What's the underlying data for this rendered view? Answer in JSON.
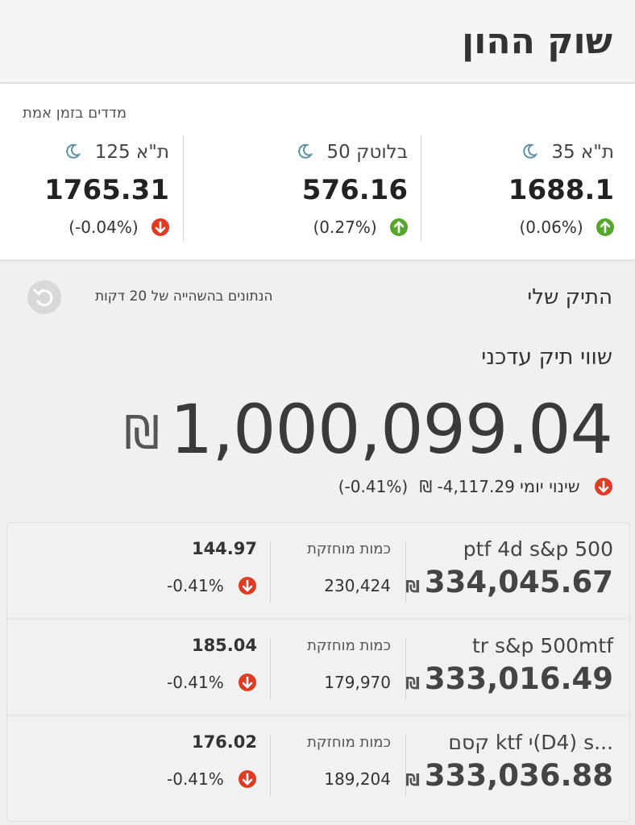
{
  "header": {
    "title": "שוק ההון"
  },
  "indices": {
    "title": "מדדים בזמן אמת",
    "items": [
      {
        "name": "ת\"א 35",
        "value": "1688.1",
        "change": "(0.06%)",
        "direction": "up",
        "icon": "moon-icon"
      },
      {
        "name": "בלוטק 50",
        "value": "576.16",
        "change": "(0.27%)",
        "direction": "up",
        "icon": "moon-icon"
      },
      {
        "name": "ת\"א 125",
        "value": "1765.31",
        "change": "(-0.04%)",
        "direction": "down",
        "icon": "moon-icon"
      }
    ]
  },
  "portfolio": {
    "title": "התיק שלי",
    "delay_note": "הנתונים בהשהייה של 20 דקות",
    "current_label": "שווי תיק עדכני",
    "total_value": "1,000,099.04",
    "currency": "₪",
    "daily_label": "שינוי יומי",
    "daily_amount": "-4,117.29",
    "daily_pct": "(-0.41%)"
  },
  "holdings": {
    "qty_label": "כמות מוחזקת",
    "rows": [
      {
        "name": "ptf 4d s&p 500",
        "value": "334,045.67",
        "qty": "230,424",
        "price": "144.97",
        "pct": "-0.41%"
      },
      {
        "name": "tr s&p 500mtf",
        "value": "333,016.49",
        "qty": "179,970",
        "price": "185.04",
        "pct": "-0.41%"
      },
      {
        "name": "קסם ktf י(D4) s...",
        "value": "333,036.88",
        "qty": "189,204",
        "price": "176.02",
        "pct": "-0.41%"
      }
    ]
  },
  "colors": {
    "up": "#56a62c",
    "down": "#e03b24",
    "moon": "#5a8fa6"
  }
}
